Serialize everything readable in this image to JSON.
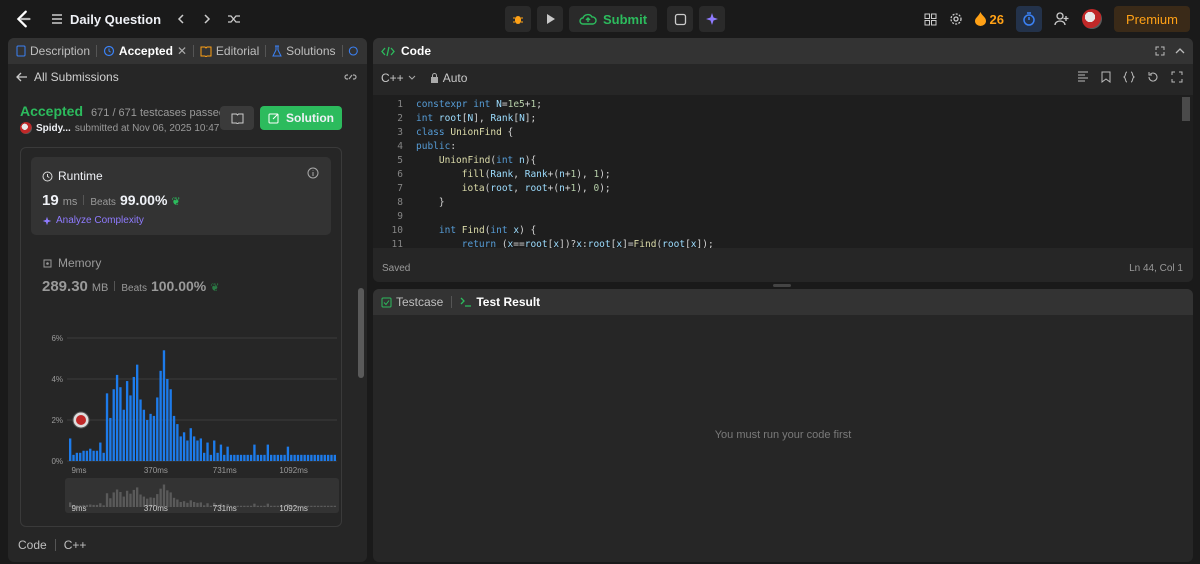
{
  "topbar": {
    "title": "Daily Question",
    "submit_label": "Submit",
    "streak": "26",
    "premium_label": "Premium"
  },
  "left_panel": {
    "tabs": [
      {
        "label": "Description"
      },
      {
        "label": "Accepted"
      },
      {
        "label": "Editorial"
      },
      {
        "label": "Solutions"
      }
    ],
    "back_label": "All Submissions",
    "status": "Accepted",
    "testcases": "671 / 671 testcases passed",
    "user": "Spidy...",
    "submitted": "submitted at Nov 06, 2025 10:47",
    "solution_label": "Solution",
    "runtime": {
      "label": "Runtime",
      "value": "19",
      "unit": "ms",
      "beats_label": "Beats",
      "beats": "99.00%",
      "analyze": "Analyze Complexity"
    },
    "memory": {
      "label": "Memory",
      "value": "289.30",
      "unit": "MB",
      "beats_label": "Beats",
      "beats": "100.00%"
    },
    "footer": {
      "code_label": "Code",
      "lang": "C++"
    }
  },
  "chart_data": {
    "type": "bar",
    "ylabels": [
      "6%",
      "4%",
      "2%",
      "0%"
    ],
    "xlabels": [
      "9ms",
      "370ms",
      "731ms",
      "1092ms"
    ],
    "ylim": [
      0,
      6
    ],
    "values": [
      1.1,
      0.3,
      0.4,
      0.4,
      0.5,
      0.5,
      0.6,
      0.5,
      0.5,
      0.9,
      0.4,
      3.3,
      2.1,
      3.5,
      4.2,
      3.6,
      2.5,
      3.9,
      3.2,
      4.1,
      4.7,
      3.0,
      2.5,
      2.0,
      2.3,
      2.2,
      3.1,
      4.4,
      5.4,
      4.0,
      3.5,
      2.2,
      1.8,
      1.2,
      1.4,
      1.0,
      1.6,
      1.2,
      1.0,
      1.1,
      0.4,
      0.9,
      0.3,
      1.0,
      0.4,
      0.8,
      0.3,
      0.7,
      0.3,
      0.3,
      0.3,
      0.3,
      0.3,
      0.3,
      0.3,
      0.8,
      0.3,
      0.3,
      0.3,
      0.8,
      0.3,
      0.3,
      0.3,
      0.3,
      0.3,
      0.7,
      0.3,
      0.3,
      0.3,
      0.3,
      0.3,
      0.3,
      0.3,
      0.3,
      0.3,
      0.3,
      0.3,
      0.3,
      0.3,
      0.3
    ]
  },
  "code_panel": {
    "title": "Code",
    "lang": "C++",
    "mode": "Auto",
    "status": "Saved",
    "cursor": "Ln 44, Col 1",
    "lines": [
      "constexpr int N=1e5+1;",
      "int root[N], Rank[N];",
      "class UnionFind {",
      "public:",
      "    UnionFind(int n){",
      "        fill(Rank, Rank+(n+1), 1);",
      "        iota(root, root+(n+1), 0);",
      "    }",
      "",
      "    int Find(int x) {",
      "        return (x==root[x])?x:root[x]=Find(root[x]);"
    ]
  },
  "test_panel": {
    "tab_testcase": "Testcase",
    "tab_result": "Test Result",
    "empty_msg": "You must run your code first"
  }
}
